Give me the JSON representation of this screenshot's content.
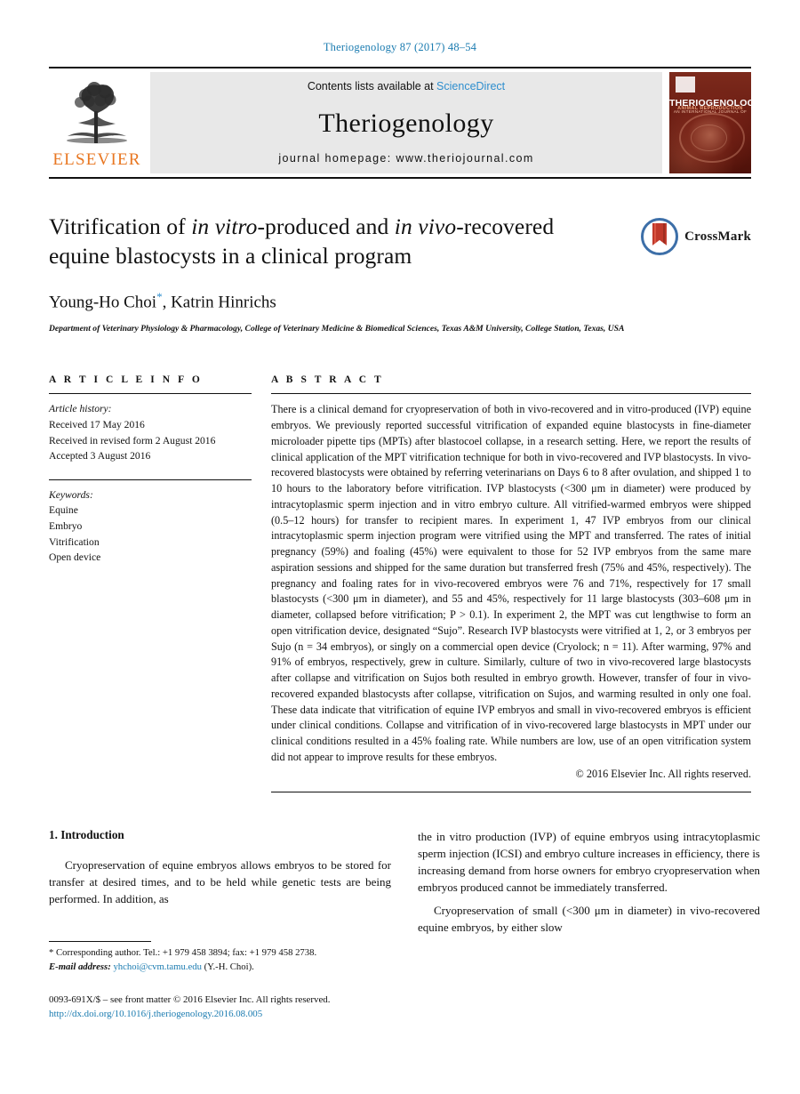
{
  "running_head": "Theriogenology 87 (2017) 48–54",
  "masthead": {
    "publisher_logo_text": "ELSEVIER",
    "contents_prefix": "Contents lists available at ",
    "contents_link": "ScienceDirect",
    "journal_name": "Theriogenology",
    "homepage": "journal homepage: www.theriojournal.com",
    "cover": {
      "title": "THERIOGENOLOGY",
      "subtitle": "ANIMAL REPRODUCTION",
      "micro_line": "AN INTERNATIONAL JOURNAL OF"
    }
  },
  "article": {
    "title_part1": "Vitrification of ",
    "title_ital1": "in vitro",
    "title_part2": "-produced and ",
    "title_ital2": "in vivo",
    "title_part3": "-recovered equine blastocysts in a clinical program",
    "authors": "Young-Ho Choi",
    "author_star": "*",
    "authors_rest": ", Katrin Hinrichs",
    "affiliation": "Department of Veterinary Physiology & Pharmacology, College of Veterinary Medicine & Biomedical Sciences, Texas A&M University, College Station, Texas, USA",
    "crossmark_label": "CrossMark"
  },
  "article_info": {
    "heading": "A R T I C L E   I N F O",
    "history_label": "Article history:",
    "history": [
      "Received 17 May 2016",
      "Received in revised form 2 August 2016",
      "Accepted 3 August 2016"
    ],
    "keywords_label": "Keywords:",
    "keywords": [
      "Equine",
      "Embryo",
      "Vitrification",
      "Open device"
    ]
  },
  "abstract": {
    "heading": "A B S T R A C T",
    "text": "There is a clinical demand for cryopreservation of both in vivo-recovered and in vitro-produced (IVP) equine embryos. We previously reported successful vitrification of expanded equine blastocysts in fine-diameter microloader pipette tips (MPTs) after blastocoel collapse, in a research setting. Here, we report the results of clinical application of the MPT vitrification technique for both in vivo-recovered and IVP blastocysts. In vivo-recovered blastocysts were obtained by referring veterinarians on Days 6 to 8 after ovulation, and shipped 1 to 10 hours to the laboratory before vitrification. IVP blastocysts (<300 μm in diameter) were produced by intracytoplasmic sperm injection and in vitro embryo culture. All vitrified-warmed embryos were shipped (0.5–12 hours) for transfer to recipient mares. In experiment 1, 47 IVP embryos from our clinical intracytoplasmic sperm injection program were vitrified using the MPT and transferred. The rates of initial pregnancy (59%) and foaling (45%) were equivalent to those for 52 IVP embryos from the same mare aspiration sessions and shipped for the same duration but transferred fresh (75% and 45%, respectively). The pregnancy and foaling rates for in vivo-recovered embryos were 76 and 71%, respectively for 17 small blastocysts (<300 μm in diameter), and 55 and 45%, respectively for 11 large blastocysts (303–608 μm in diameter, collapsed before vitrification; P > 0.1). In experiment 2, the MPT was cut lengthwise to form an open vitrification device, designated “Sujo”. Research IVP blastocysts were vitrified at 1, 2, or 3 embryos per Sujo (n = 34 embryos), or singly on a commercial open device (Cryolock; n = 11). After warming, 97% and 91% of embryos, respectively, grew in culture. Similarly, culture of two in vivo-recovered large blastocysts after collapse and vitrification on Sujos both resulted in embryo growth. However, transfer of four in vivo-recovered expanded blastocysts after collapse, vitrification on Sujos, and warming resulted in only one foal. These data indicate that vitrification of equine IVP embryos and small in vivo-recovered embryos is efficient under clinical conditions. Collapse and vitrification of in vivo-recovered large blastocysts in MPT under our clinical conditions resulted in a 45% foaling rate. While numbers are low, use of an open vitrification system did not appear to improve results for these embryos.",
    "copyright": "© 2016 Elsevier Inc. All rights reserved."
  },
  "body": {
    "section_number_title": "1.  Introduction",
    "left_paragraph": "Cryopreservation of equine embryos allows embryos to be stored for transfer at desired times, and to be held while genetic tests are being performed. In addition, as",
    "right_paragraph_1": "the in vitro production (IVP) of equine embryos using intracytoplasmic sperm injection (ICSI) and embryo culture increases in efficiency, there is increasing demand from horse owners for embryo cryopreservation when embryos produced cannot be immediately transferred.",
    "right_paragraph_2": "Cryopreservation of small (<300 μm in diameter) in vivo-recovered equine embryos, by either slow"
  },
  "footnotes": {
    "corresponding": "*  Corresponding author. Tel.: +1 979 458 3894; fax: +1 979 458 2738.",
    "email_label": "E-mail address:",
    "email": "yhchoi@cvm.tamu.edu",
    "email_suffix": "(Y.-H. Choi).",
    "issn": "0093-691X/$ – see front matter © 2016 Elsevier Inc. All rights reserved.",
    "doi": "http://dx.doi.org/10.1016/j.theriogenology.2016.08.005"
  },
  "colors": {
    "link": "#1a7bb0",
    "sciencedirect": "#2e8ece",
    "elsevier_orange": "#E87722",
    "band_gray": "#e8e8e8"
  }
}
